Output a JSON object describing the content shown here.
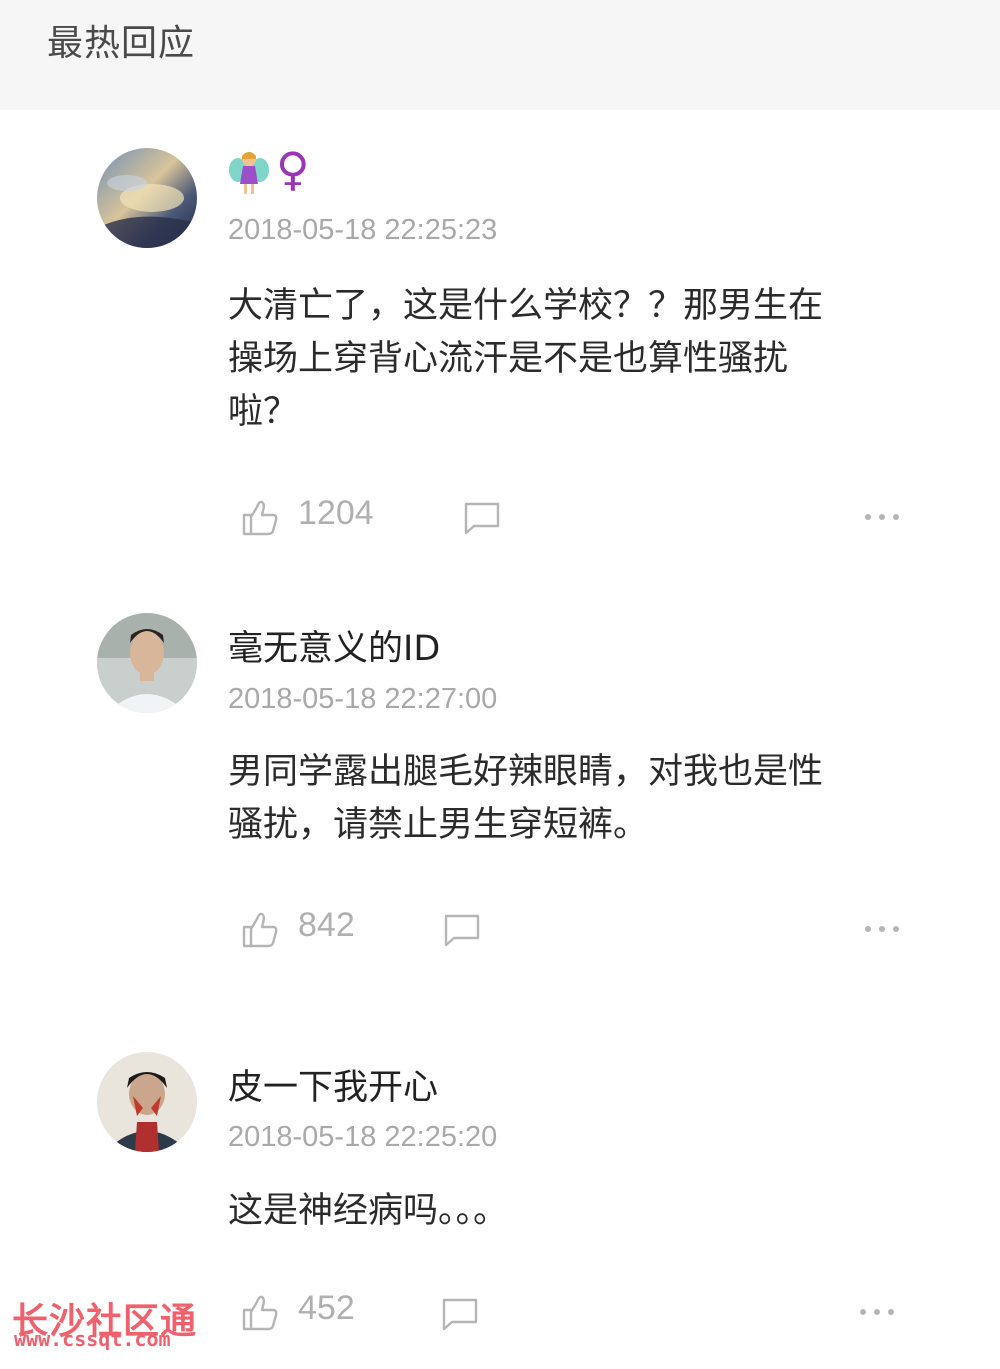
{
  "header": {
    "title": "最热回应"
  },
  "comments": [
    {
      "username": "",
      "badges": [
        "fairy-emoji",
        "female-sign"
      ],
      "female_symbol": "♀",
      "timestamp": "2018-05-18 22:25:23",
      "lines": [
        "大清亡了，这是什么学校？？那男生在",
        "操场上穿背心流汗是不是也算性骚扰",
        "啦？"
      ],
      "likes": "1204"
    },
    {
      "username": "毫无意义的ID",
      "timestamp": "2018-05-18 22:27:00",
      "lines": [
        "男同学露出腿毛好辣眼睛，对我也是性",
        "骚扰，请禁止男生穿短裤。"
      ],
      "likes": "842"
    },
    {
      "username": "皮一下我开心",
      "timestamp": "2018-05-18 22:25:20",
      "lines": [
        "这是神经病吗。。。"
      ],
      "likes": "452"
    }
  ],
  "watermark": {
    "name": "长沙社区通",
    "url": "www.cssqt.com"
  },
  "colors": {
    "header_bg": "#f6f6f6",
    "timestamp": "#a9a9a9",
    "icon": "#b5b5b5",
    "watermark": "#f0606d"
  }
}
